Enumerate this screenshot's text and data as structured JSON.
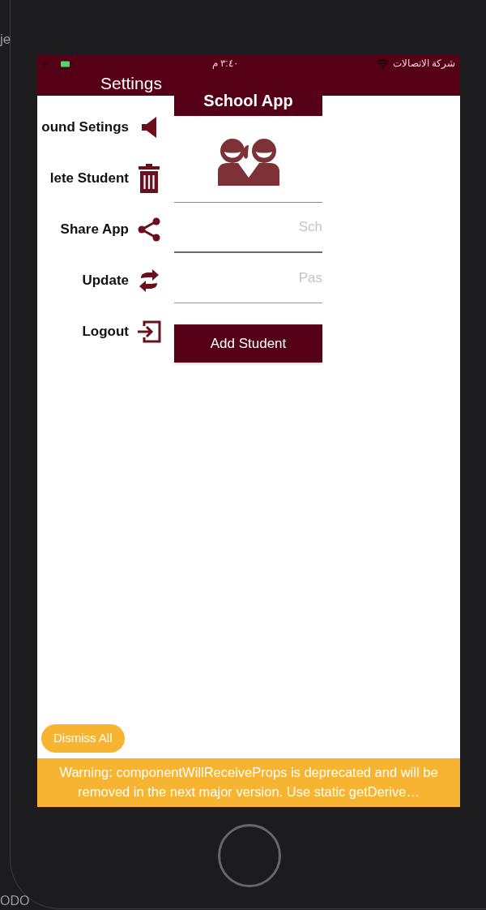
{
  "editor_fragments": [
    "je",
    "ODO"
  ],
  "status_bar": {
    "time": "٣:٤٠ م",
    "carrier": "شركة الاتصالات"
  },
  "drawer": {
    "title": "Settings",
    "items": [
      {
        "label": "ound Setings",
        "kind": "speaker"
      },
      {
        "label": "lete Student",
        "kind": "trash"
      },
      {
        "label": "Share App",
        "kind": "share"
      },
      {
        "label": "Update",
        "kind": "update"
      },
      {
        "label": "Logout",
        "kind": "logout"
      }
    ]
  },
  "panel": {
    "title": "School App",
    "fields": [
      {
        "placeholder": "Sch"
      },
      {
        "placeholder": "Pas"
      }
    ],
    "button": "Add Student"
  },
  "dismiss_button": "Dismiss All",
  "warning": "Warning: componentWillReceiveProps is deprecated and will be removed in the next major version. Use static getDerive…"
}
